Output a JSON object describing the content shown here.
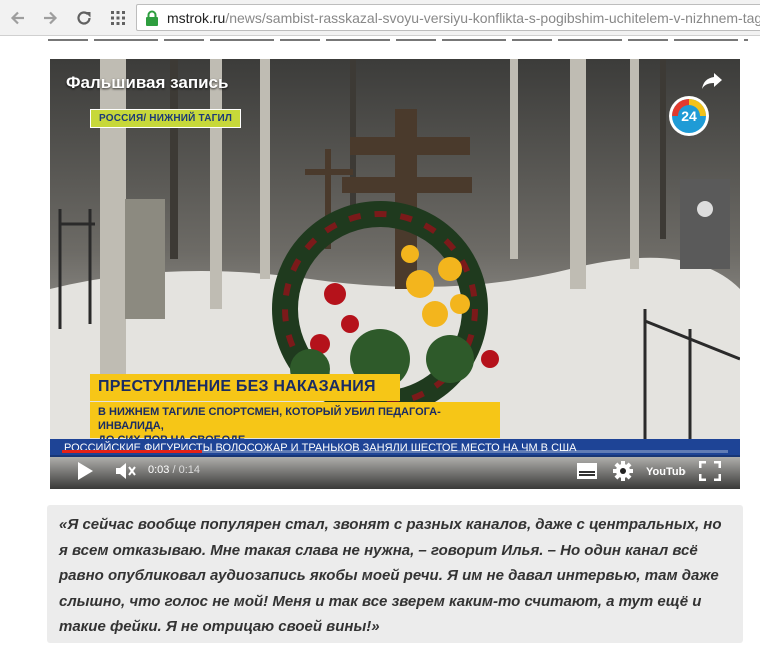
{
  "browser": {
    "url_host": "mstrok.ru",
    "url_path": "/news/sambist-rasskazal-svoyu-versiyu-konflikta-s-pogibshim-uchitelem-v-nizhnem-tagile-i-i"
  },
  "video": {
    "title": "Фальшивая запись",
    "location_badge": "РОССИЯ/ НИЖНИЙ ТАГИЛ",
    "channel_logo_text": "24",
    "headline": "ПРЕСТУПЛЕНИЕ БЕЗ НАКАЗАНИЯ",
    "subline_1": "В НИЖНЕМ ТАГИЛЕ СПОРТСМЕН, КОТОРЫЙ УБИЛ ПЕДАГОГА-ИНВАЛИДА,",
    "subline_2": "ДО СИХ ПОР НА СВОБОДЕ",
    "ticker": "РОССИЙСКИЕ ФИГУРИСТЫ ВОЛОСОЖАР И ТРАНЬКОВ ЗАНЯЛИ ШЕСТОЕ МЕСТО НА ЧМ В США",
    "current_time": "0:03",
    "total_time": "0:14",
    "time_separator": " / ",
    "progress_fraction": 0.21,
    "youtube_label": "YouTube"
  },
  "quote": {
    "text": "«Я сейчас вообще популярен стал, звонят с разных каналов, даже с центральных, но я всем отказываю. Мне такая слава не нужна, – говорит Илья. – Но один канал всё равно опубликовал аудиозапись якобы моей речи. Я им не давал интервью, там даже слышно, что голос не мой! Меня и так все зверем каким-то считают, а тут ещё и такие фейки. Я не отрицаю своей вины!»"
  },
  "colors": {
    "accent_red": "#e62117",
    "badge_yellow": "#f6c617",
    "ticker_blue": "#1e4496",
    "secure_green": "#2e9e3f"
  },
  "icons": [
    "back-arrow-icon",
    "forward-arrow-icon",
    "reload-icon",
    "apps-grid-icon",
    "lock-icon",
    "share-icon",
    "play-icon",
    "volume-icon",
    "subtitles-icon",
    "settings-gear-icon",
    "fullscreen-icon"
  ]
}
